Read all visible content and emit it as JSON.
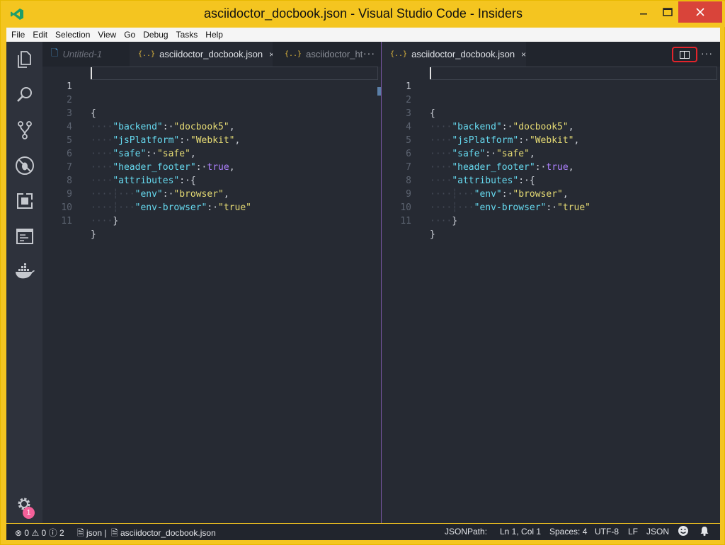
{
  "window": {
    "title": "asciidoctor_docbook.json - Visual Studio Code - Insiders",
    "minimize_icon": "minimize-icon",
    "maximize_icon": "maximize-icon",
    "close_icon": "close-icon"
  },
  "menu": [
    "File",
    "Edit",
    "Selection",
    "View",
    "Go",
    "Debug",
    "Tasks",
    "Help"
  ],
  "activity_bar": {
    "icons": [
      "explorer-icon",
      "search-icon",
      "source-control-icon",
      "debug-icon",
      "extensions-icon",
      "terminal-icon",
      "docker-icon"
    ],
    "settings_icon": "gear-icon",
    "settings_badge": "1"
  },
  "left_group": {
    "tabs": [
      {
        "label": "Untitled-1",
        "icon": "file-icon",
        "active": false
      },
      {
        "label": "asciidoctor_docbook.json",
        "icon": "{..}",
        "active": true,
        "close": "×"
      },
      {
        "label": "asciidoctor_htm",
        "icon": "{..}",
        "active": false
      }
    ],
    "more": "···"
  },
  "right_group": {
    "tabs": [
      {
        "label": "asciidoctor_docbook.json",
        "icon": "{..}",
        "active": true,
        "close": "×"
      }
    ],
    "split_icon": "split-editor-icon",
    "more": "···"
  },
  "code": {
    "line_numbers": [
      "1",
      "2",
      "3",
      "4",
      "5",
      "6",
      "7",
      "8",
      "9",
      "10",
      "11"
    ],
    "keys": {
      "backend": "\"backend\"",
      "jsPlatform": "\"jsPlatform\"",
      "safe": "\"safe\"",
      "header_footer": "\"header_footer\"",
      "attributes": "\"attributes\"",
      "env": "\"env\"",
      "env_browser": "\"env-browser\""
    },
    "values": {
      "backend": "\"docbook5\"",
      "jsPlatform": "\"Webkit\"",
      "safe": "\"safe\"",
      "header_footer": "true",
      "env": "\"browser\"",
      "env_browser": "\"true\""
    },
    "open_brace": "{",
    "close_brace": "}"
  },
  "status_bar": {
    "errors": "0",
    "warnings": "0",
    "info": "2",
    "language_left": "json",
    "file": "asciidoctor_docbook.json",
    "jsonpath": "JSONPath:",
    "position": "Ln 1, Col 1",
    "spaces": "Spaces: 4",
    "encoding": "UTF-8",
    "eol": "LF",
    "language": "JSON"
  }
}
